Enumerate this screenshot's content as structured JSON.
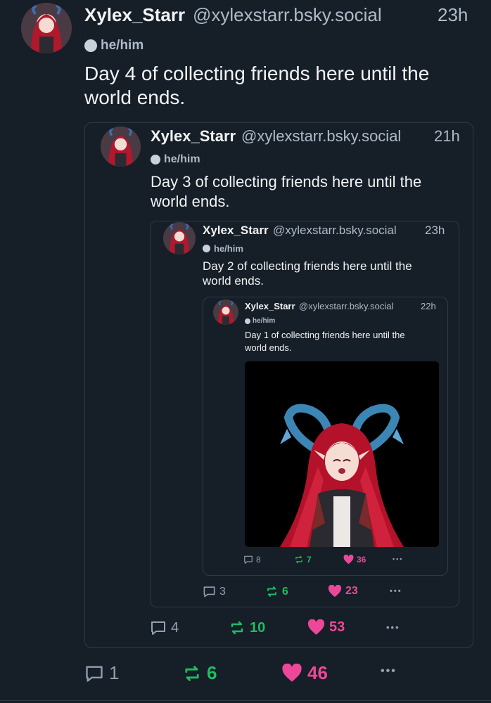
{
  "post": {
    "author_name": "Xylex_Starr",
    "author_handle": "@xylexstarr.bsky.social",
    "time": "23h",
    "pronouns": "he/him",
    "text_line1": "Day 4 of collecting friends here until the",
    "text_line2": "world ends.",
    "actions": {
      "replies": "1",
      "reposts": "6",
      "likes": "46",
      "more": "•••"
    }
  },
  "quote1": {
    "author_name": "Xylex_Starr",
    "author_handle": "@xylexstarr.bsky.social",
    "time": "21h",
    "pronouns": "he/him",
    "text_line1": "Day 3 of collecting friends here until the",
    "text_line2": "world ends.",
    "actions": {
      "replies": "4",
      "reposts": "10",
      "likes": "53",
      "more": "•••"
    }
  },
  "quote2": {
    "author_name": "Xylex_Starr",
    "author_handle": "@xylexstarr.bsky.social",
    "time": "23h",
    "pronouns": "he/him",
    "text_line1": "Day 2 of collecting friends here until the",
    "text_line2": "world ends.",
    "actions": {
      "replies": "3",
      "reposts": "6",
      "likes": "23",
      "more": "•••"
    }
  },
  "quote3": {
    "author_name": "Xylex_Starr",
    "author_handle": "@xylexstarr.bsky.social",
    "time": "22h",
    "pronouns": "he/him",
    "text_line1": "Day 1 of collecting friends here until the",
    "text_line2": "world ends.",
    "actions": {
      "replies": "8",
      "reposts": "7",
      "likes": "36",
      "more": "•••"
    }
  },
  "colors": {
    "background": "#161e27",
    "border": "#2e3a48",
    "muted": "#aebbc9",
    "repost": "#20bc62",
    "like": "#ec4899"
  },
  "icons": [
    "reply-icon",
    "repost-icon",
    "heart-icon",
    "more-icon",
    "pronoun-badge-icon",
    "avatar-image"
  ]
}
